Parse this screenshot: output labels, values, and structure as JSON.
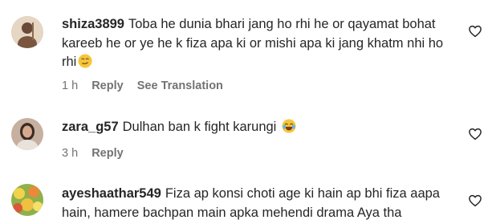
{
  "comments": [
    {
      "username": "shiza3899",
      "text": "Toba he dunia bhari jang ho rhi he or qayamat bohat kareeb he or ye he k fiza apa ki or mishi apa ki jang khatm nhi ho rhi",
      "emoji": "smirking-face-emoji",
      "time": "1 h",
      "reply_label": "Reply",
      "translation_label": "See Translation",
      "like_icon": "heart-outline-icon"
    },
    {
      "username": "zara_g57",
      "text": "Dulhan ban k fight karungi",
      "emoji": "tears-of-joy-emoji",
      "time": "3 h",
      "reply_label": "Reply",
      "like_icon": "heart-outline-icon"
    },
    {
      "username": "ayeshaathar549",
      "text": "Fiza ap konsi choti age ki hain ap bhi fiza aapa hain, hamere bachpan main apka mehendi drama Aya tha",
      "like_icon": "heart-outline-icon"
    }
  ],
  "colors": {
    "text": "#262626",
    "secondary_text": "#737373",
    "background": "#ffffff"
  }
}
